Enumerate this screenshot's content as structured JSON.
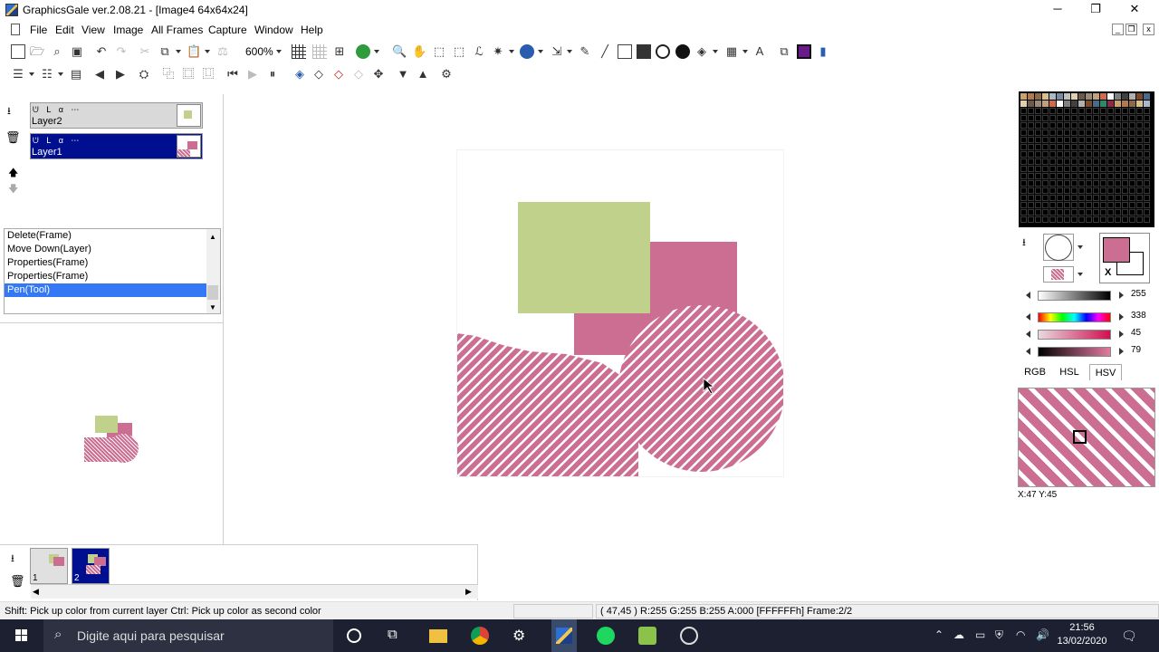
{
  "window": {
    "title": "GraphicsGale ver.2.08.21 - [Image4 64x64x24]",
    "controls": {
      "minimize": "─",
      "maximize": "❐",
      "close": "✕"
    }
  },
  "menu": [
    "File",
    "Edit",
    "View",
    "Image",
    "All Frames",
    "Capture",
    "Window",
    "Help"
  ],
  "mdi_controls": [
    "_",
    "❐",
    "x"
  ],
  "toolbar": {
    "zoom": "600%"
  },
  "layers": [
    {
      "name": "Layer2",
      "flags": "ᕫ ᒪ α ⋯",
      "selected": false
    },
    {
      "name": "Layer1",
      "flags": "ᕫ ᒪ α ⋯",
      "selected": true
    }
  ],
  "history": [
    "Delete(Frame)",
    "Move Down(Layer)",
    "Properties(Frame)",
    "Properties(Frame)",
    "Pen(Tool)"
  ],
  "frames": [
    "1",
    "2"
  ],
  "colors": {
    "green": "#bfd18a",
    "pink": "#cc6e91",
    "selection": "#000f8f",
    "history_selection": "#3478f6"
  },
  "color_panel": {
    "values": [
      "255",
      "338",
      "45",
      "79"
    ],
    "tabs": [
      "RGB",
      "HSL",
      "HSV"
    ],
    "primary_x": "X"
  },
  "coords": "X:47 Y:45",
  "status": {
    "left": "Shift: Pick up color from current layer  Ctrl: Pick up color as second color",
    "right": "( 47,45 ) R:255 G:255 B:255 A:000  [FFFFFFh]  Frame:2/2"
  },
  "taskbar": {
    "search_placeholder": "Digite aqui para pesquisar",
    "time": "21:56",
    "date": "13/02/2020"
  }
}
